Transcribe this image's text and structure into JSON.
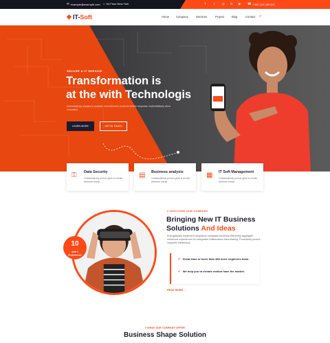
{
  "topbar": {
    "email": "example@example.com",
    "address": "54 Flour New York",
    "phone": "+880 123 456 541",
    "social_icons": [
      "facebook-icon",
      "twitter-icon",
      "instagram-icon",
      "linkedin-icon",
      "youtube-icon"
    ]
  },
  "header": {
    "logo_a": "IT-",
    "logo_b": "Soft",
    "nav": [
      "Home",
      "Company",
      "Services",
      "Project",
      "Blog",
      "Contact"
    ]
  },
  "hero": {
    "eyebrow": "SECURE & IT SERVICE",
    "title_line1": "Transformation is",
    "title_line2": "at the with Technologis",
    "paragraph": "Authoritatively transform scalable manufactured products before response. Authoritatively drive innovative.",
    "btn_primary": "LEARN MORE",
    "btn_secondary": "GET IN TOUCH"
  },
  "services": [
    {
      "title": "Data Security",
      "desc": "Collaboratively pursue gitan is results whereas robust."
    },
    {
      "title": "Business analysis",
      "desc": "Collaboratively pursue gitan is results whereas robust."
    },
    {
      "title": "IT Soft Management",
      "desc": "Collaboratively pursue gitan is results whereas robust."
    }
  ],
  "about": {
    "kicker": "// DISCOVER OUR COMPANY",
    "title_a": "Bringing New IT Business",
    "title_b": "Solutions ",
    "title_hl": "And Ideas",
    "paragraph": "Energistically implement ubiquitous metadata functional Efficiently aggregate enhanced experiences for integrated collaboration idea-sharing. Proactively pursue impactful intellectual.",
    "badge_number": "10",
    "badge_label_a": "years",
    "badge_label_b": "Experience",
    "list": [
      "Great team of more than 480 more engineers team.",
      "We help you to elevate motion have the market."
    ],
    "read_more": "READ MORE →"
  },
  "offer": {
    "kicker": "// WHAT OUR COMPANY OFFER",
    "title": "Business Shape Solution"
  },
  "colors": {
    "accent": "#ff4a17",
    "dark": "#1b1b2f"
  }
}
